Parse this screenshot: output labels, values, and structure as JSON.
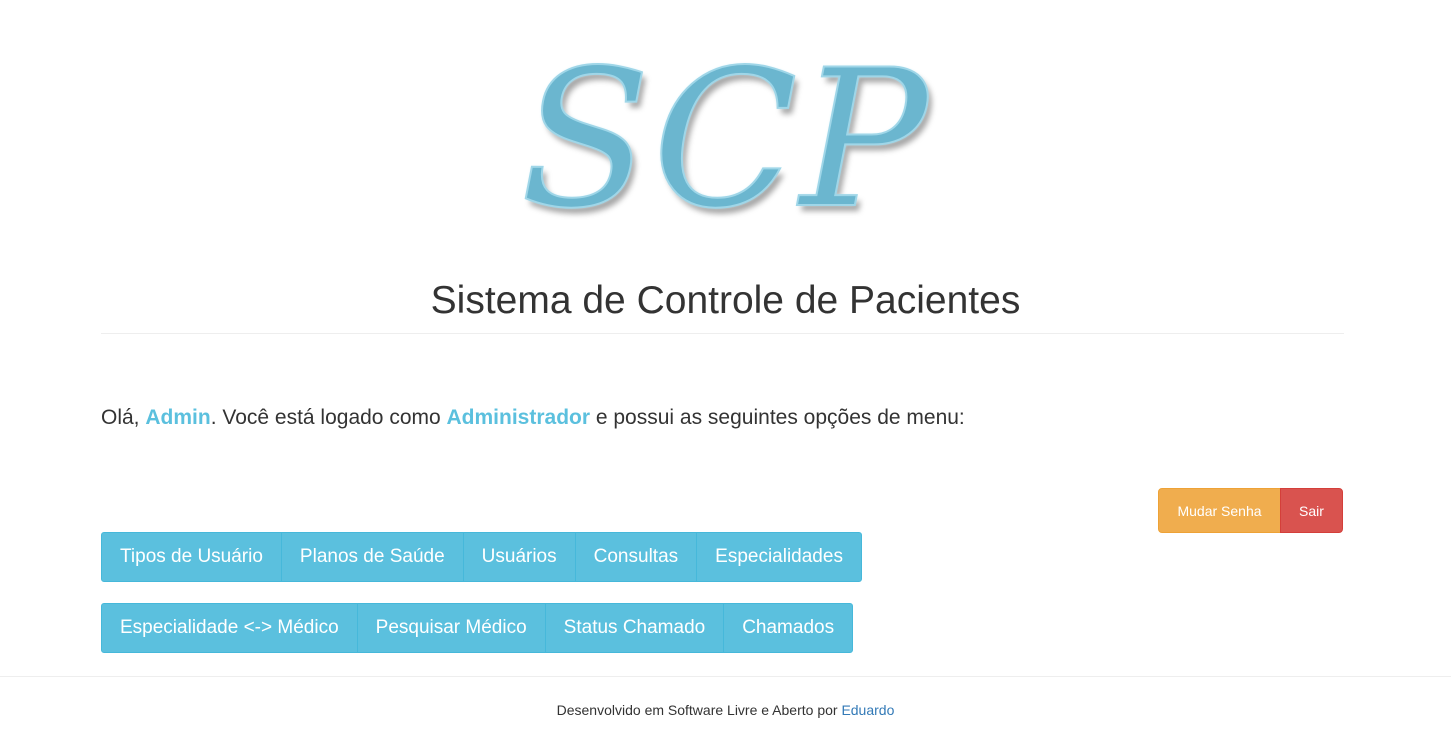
{
  "logo": {
    "text": "SCP",
    "color": "#6bb6cf"
  },
  "header": {
    "title": "Sistema de Controle de Pacientes"
  },
  "greeting": {
    "prefix": "Olá, ",
    "user": "Admin",
    "middle": ". Você está logado como ",
    "role": "Administrador",
    "suffix": " e possui as seguintes opções de menu:"
  },
  "account_actions": {
    "change_password_label": "Mudar Senha",
    "logout_label": "Sair"
  },
  "menu": {
    "row1": [
      {
        "label": "Tipos de Usuário"
      },
      {
        "label": "Planos de Saúde"
      },
      {
        "label": "Usuários"
      },
      {
        "label": "Consultas"
      },
      {
        "label": "Especialidades"
      }
    ],
    "row2": [
      {
        "label": "Especialidade <-> Médico"
      },
      {
        "label": "Pesquisar Médico"
      },
      {
        "label": "Status Chamado"
      },
      {
        "label": "Chamados"
      }
    ]
  },
  "footer": {
    "text": "Desenvolvido em Software Livre e Aberto por ",
    "author_link": "Eduardo"
  },
  "colors": {
    "info": "#5bc0de",
    "warning": "#f0ad4e",
    "danger": "#d9534f",
    "link": "#337ab7"
  }
}
